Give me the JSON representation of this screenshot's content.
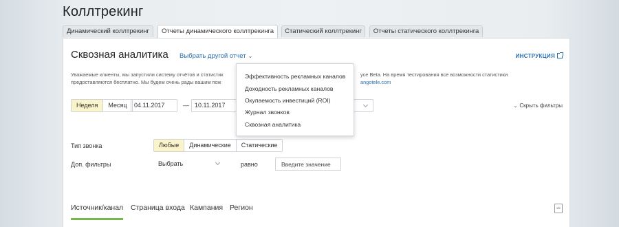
{
  "page": {
    "title": "Коллтрекинг"
  },
  "tabs": [
    {
      "label": "Динамический коллтрекинг",
      "active": false
    },
    {
      "label": "Отчеты динамического коллтрекинга",
      "active": true
    },
    {
      "label": "Статический коллтрекинг",
      "active": false
    },
    {
      "label": "Отчеты статического коллтрекинга",
      "active": false
    }
  ],
  "report": {
    "title": "Сквозная аналитика",
    "choose_label": "Выбрать другой отчет",
    "instruction_label": "ИНСТРУКЦИЯ"
  },
  "notice": {
    "line1_left": "Уважаемые клиенты, мы запустили систему отчётов и статистик",
    "line1_right": "усе Beta. На время тестирования все возможности статистики",
    "line2_left": "предоставляются бесплатно. Мы будем очень рады вашим пож",
    "line2_right": "angotele.com"
  },
  "period": {
    "options": [
      {
        "label": "Неделя",
        "active": true
      },
      {
        "label": "Месяц",
        "active": false
      }
    ],
    "date_from": "04.11.2017",
    "separator": "—",
    "date_to": "10.11.2017"
  },
  "hide_filters_label": "Скрыть фильтры",
  "call_type": {
    "label": "Тип звонка",
    "options": [
      {
        "label": "Любые",
        "active": true
      },
      {
        "label": "Динамические",
        "active": false
      },
      {
        "label": "Статические",
        "active": false
      }
    ]
  },
  "extra_filters": {
    "label": "Доп. фильтры",
    "select_value": "Выбрать",
    "operator": "равно",
    "value_placeholder": "Введите значение"
  },
  "bottom_tabs": [
    {
      "label": "Источник/канал",
      "active": true
    },
    {
      "label": "Страница входа",
      "active": false
    },
    {
      "label": "Кампания",
      "active": false
    },
    {
      "label": "Регион",
      "active": false
    }
  ],
  "report_menu": [
    "Эффективность рекламных каналов",
    "Доходность рекламных каналов",
    "Окупаемость инвестиций (ROI)",
    "Журнал звонков",
    "Сквозная аналитика"
  ],
  "colors": {
    "link": "#2a6fb0",
    "active_segment": "#fbf3c9",
    "active_tab_underline": "#75b84a"
  }
}
